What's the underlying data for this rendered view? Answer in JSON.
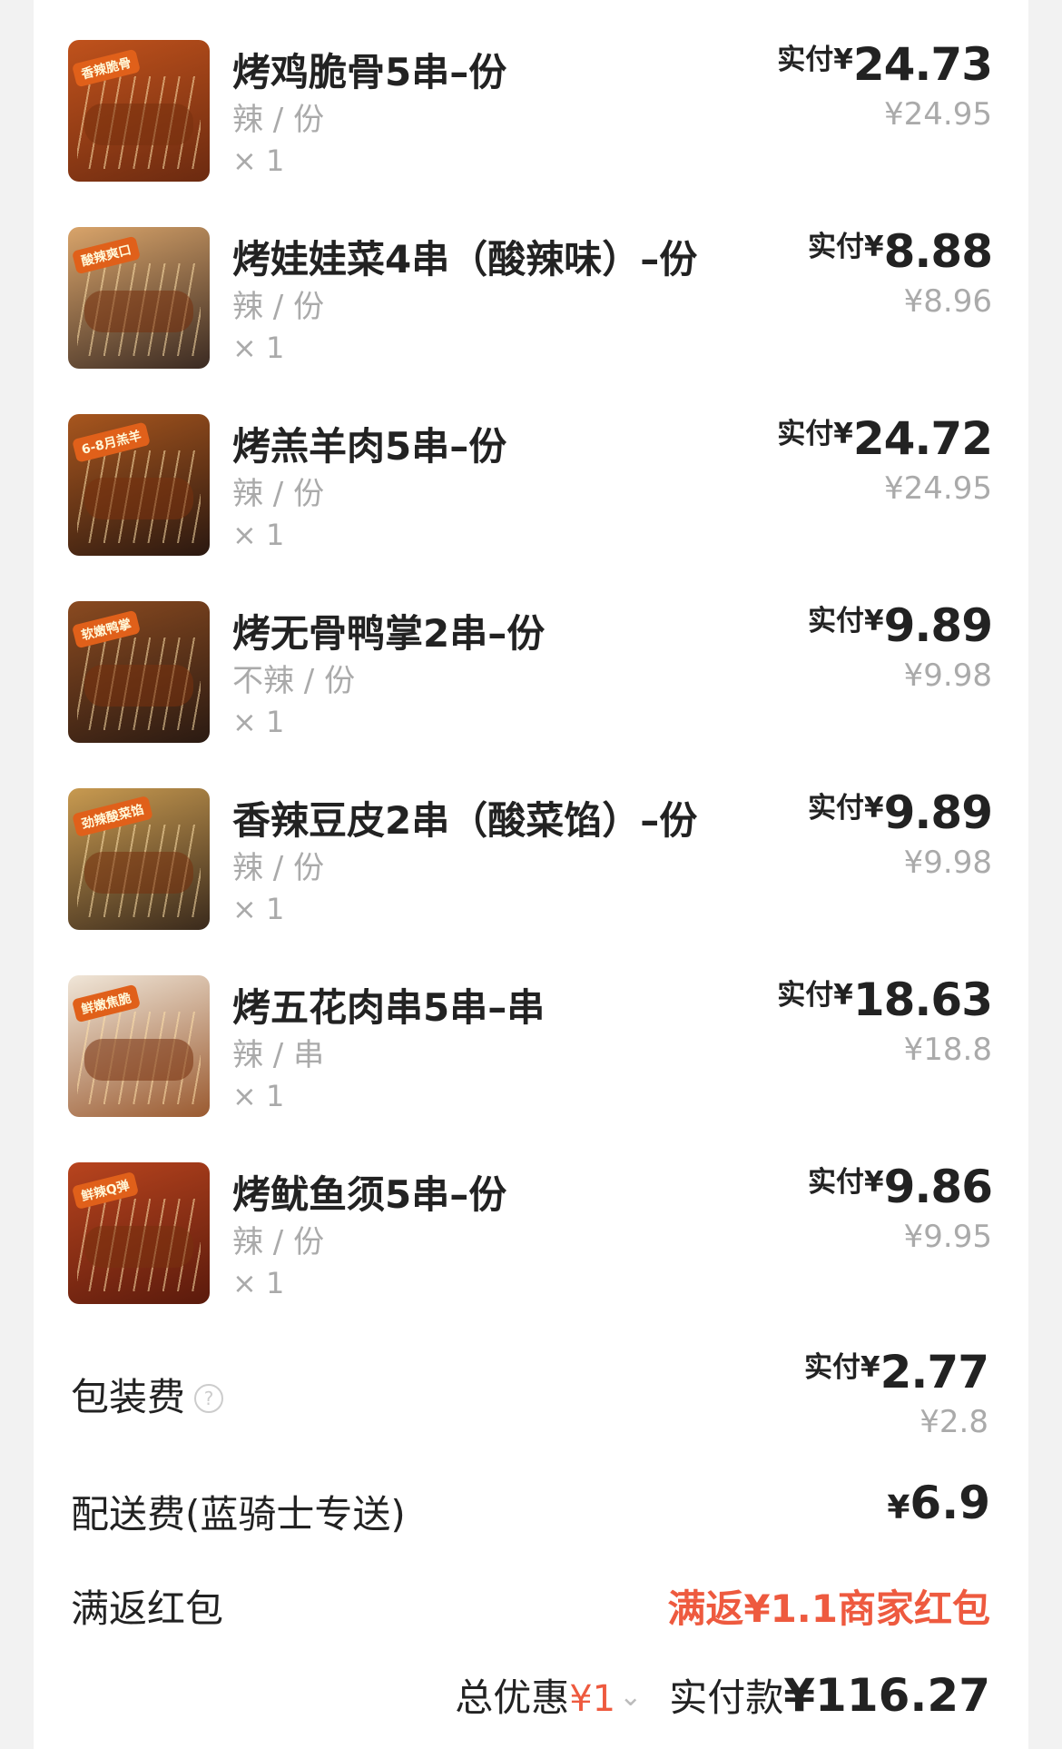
{
  "items": [
    {
      "name": "烤鸡脆骨5串–份",
      "spec": "辣 / 份",
      "qty": "× 1",
      "paid_label": "实付¥",
      "paid": "24.73",
      "original": "¥24.95",
      "badge": "香辣脆骨",
      "thumb_colors": [
        "#c0521c",
        "#6b2a10"
      ]
    },
    {
      "name": "烤娃娃菜4串（酸辣味）–份",
      "spec": "辣 / 份",
      "qty": "× 1",
      "paid_label": "实付¥",
      "paid": "8.88",
      "original": "¥8.96",
      "badge": "酸辣爽口",
      "thumb_colors": [
        "#d9a46a",
        "#3a2a22"
      ]
    },
    {
      "name": "烤羔羊肉5串–份",
      "spec": "辣 / 份",
      "qty": "× 1",
      "paid_label": "实付¥",
      "paid": "24.72",
      "original": "¥24.95",
      "badge": "6-8月羔羊",
      "thumb_colors": [
        "#a8561e",
        "#2a1810"
      ]
    },
    {
      "name": "烤无骨鸭掌2串–份",
      "spec": "不辣 / 份",
      "qty": "× 1",
      "paid_label": "实付¥",
      "paid": "9.89",
      "original": "¥9.98",
      "badge": "软嫩鸭掌",
      "thumb_colors": [
        "#8a4a20",
        "#2a1a12"
      ]
    },
    {
      "name": "香辣豆皮2串（酸菜馅）–份",
      "spec": "辣 / 份",
      "qty": "× 1",
      "paid_label": "实付¥",
      "paid": "9.89",
      "original": "¥9.98",
      "badge": "劲辣酸菜馅",
      "thumb_colors": [
        "#c89a50",
        "#3a2a1c"
      ]
    },
    {
      "name": "烤五花肉串5串–串",
      "spec": "辣 / 串",
      "qty": "× 1",
      "paid_label": "实付¥",
      "paid": "18.63",
      "original": "¥18.8",
      "badge": "鲜嫩焦脆",
      "thumb_colors": [
        "#f0e6d8",
        "#9a5a30"
      ]
    },
    {
      "name": "烤鱿鱼须5串–份",
      "spec": "辣 / 份",
      "qty": "× 1",
      "paid_label": "实付¥",
      "paid": "9.86",
      "original": "¥9.95",
      "badge": "鲜辣Q弹",
      "thumb_colors": [
        "#b8441e",
        "#5a1a0c"
      ]
    }
  ],
  "packaging": {
    "label": "包装费",
    "help_icon": "question-circle-icon",
    "paid_label": "实付¥",
    "paid": "2.77",
    "original": "¥2.8"
  },
  "delivery": {
    "label": "配送费(蓝骑士专送)",
    "currency": "¥",
    "amount": "6.9"
  },
  "rebate": {
    "label": "满返红包",
    "value": "满返¥1.1商家红包"
  },
  "summary": {
    "discount_label": "总优惠",
    "discount_amount": "¥1",
    "chevron_icon": "chevron-down-icon",
    "pay_label": "实付款",
    "pay_amount": "¥116.27"
  },
  "colors": {
    "accent_red": "#ee5a3f",
    "muted_text": "#aaaaaa",
    "background": "#f2f2f2"
  }
}
